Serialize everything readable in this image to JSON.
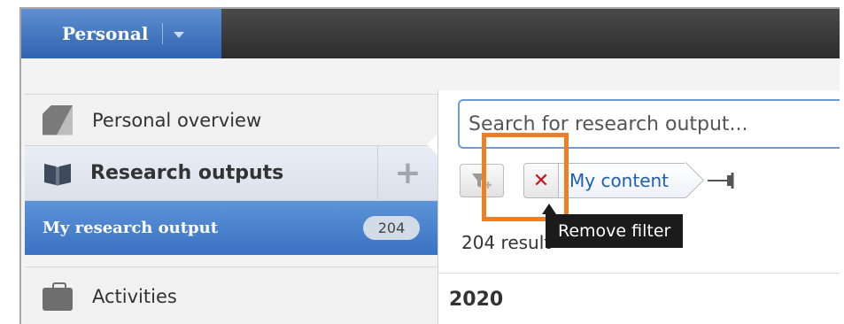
{
  "topbar": {
    "personal_tab": "Personal"
  },
  "sidebar": {
    "items": [
      {
        "label": "Personal overview",
        "icon": "overview-icon"
      },
      {
        "label": "Research outputs",
        "icon": "book-icon",
        "add_icon": "plus-icon"
      },
      {
        "label": "My research output",
        "count": "204"
      },
      {
        "label": "Activities",
        "icon": "briefcase-icon"
      }
    ]
  },
  "main": {
    "search_placeholder": "Search for research output...",
    "filter": {
      "chip_label": "My content",
      "remove_icon": "x-icon"
    },
    "tooltip": "Remove filter",
    "results_count": "204 result",
    "year": "2020"
  },
  "colors": {
    "accent_blue": "#3a72c3",
    "highlight_orange": "#ee7f24",
    "remove_red": "#c0141a"
  }
}
